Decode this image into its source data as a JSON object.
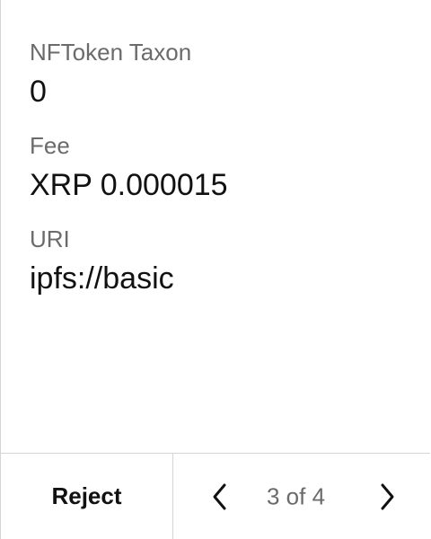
{
  "fields": [
    {
      "label": "NFToken Taxon",
      "value": "0"
    },
    {
      "label": "Fee",
      "value": "XRP 0.000015"
    },
    {
      "label": "URI",
      "value": "ipfs://basic"
    }
  ],
  "footer": {
    "reject_label": "Reject",
    "pager": {
      "text": "3 of 4",
      "prev_icon": "chevron-left-icon",
      "next_icon": "chevron-right-icon"
    }
  },
  "colors": {
    "label": "#6b6b6b",
    "value": "#111111",
    "divider": "#d4d4d4"
  }
}
